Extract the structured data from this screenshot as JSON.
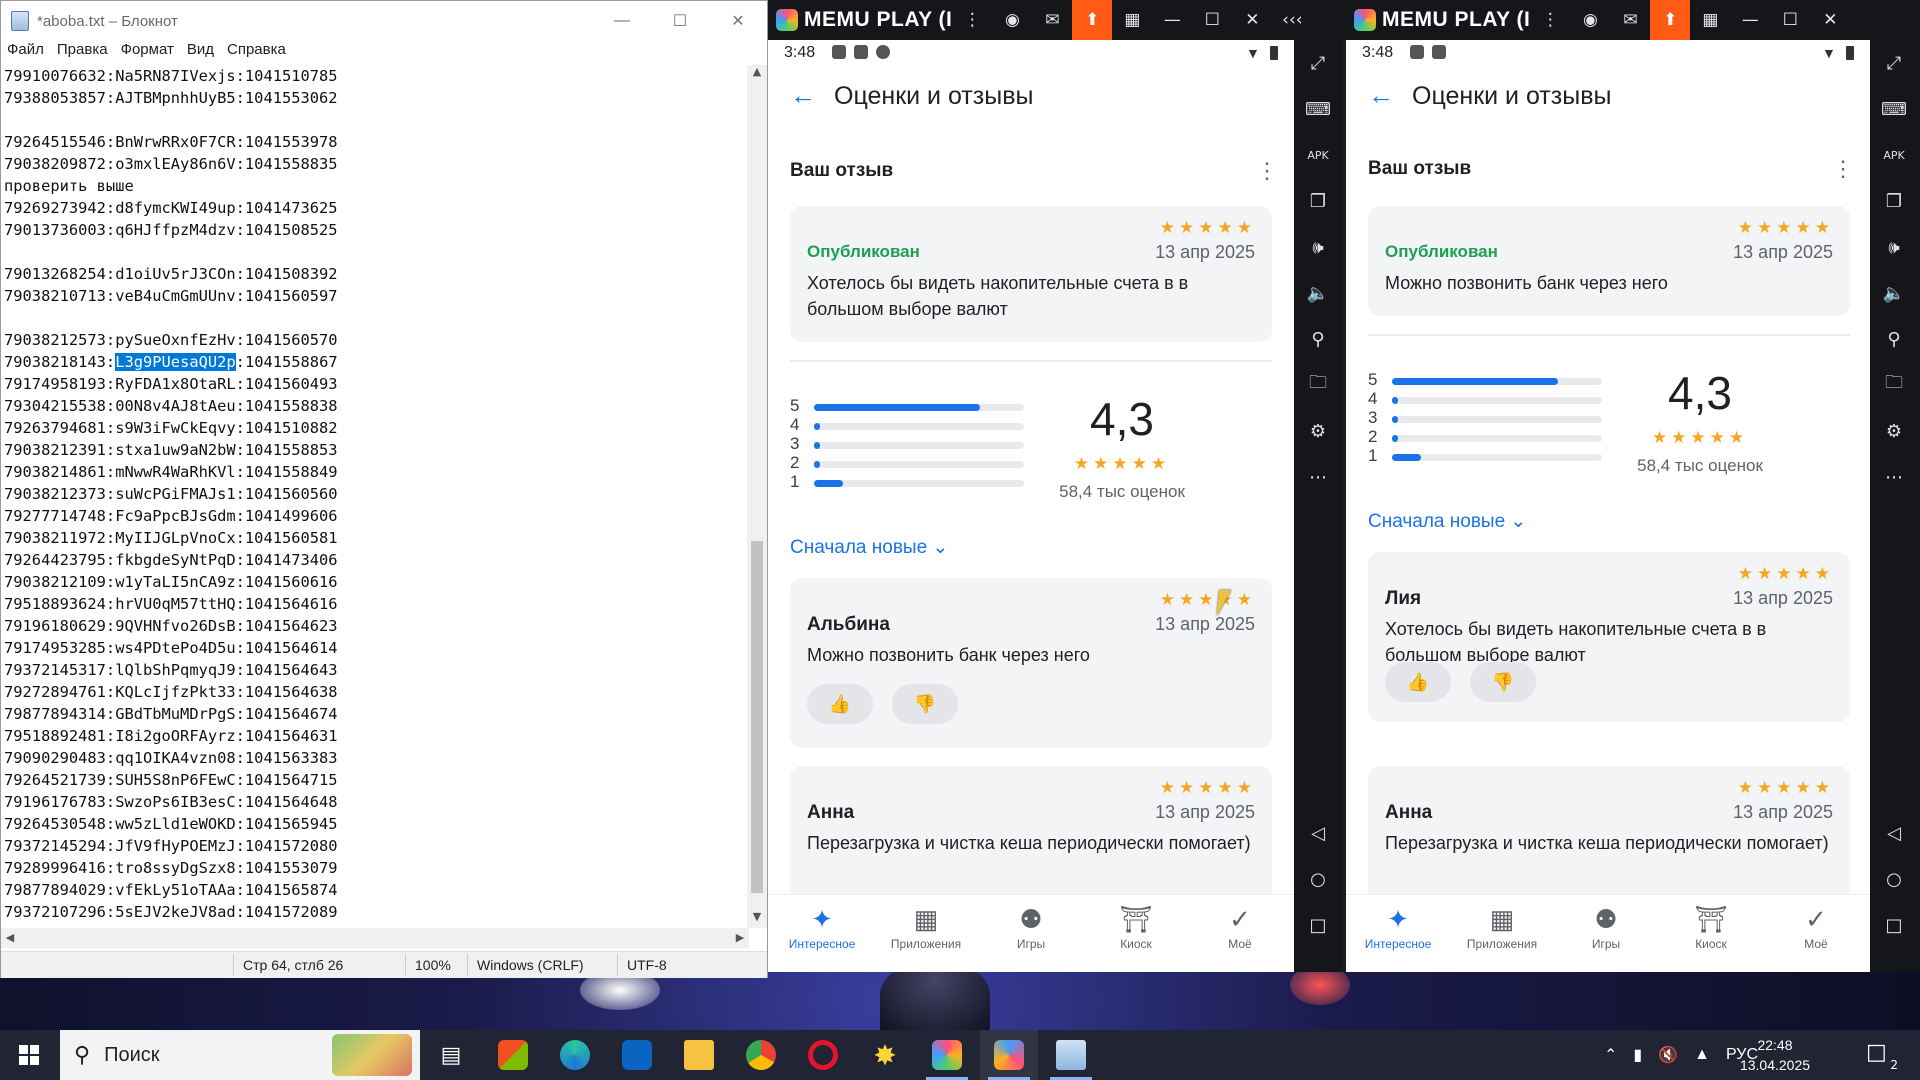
{
  "notepad": {
    "title": "*aboba.txt – Блокнот",
    "menu": [
      "Файл",
      "Правка",
      "Формат",
      "Вид",
      "Справка"
    ],
    "lines": [
      {
        "pre": "79910076632:Na5RN87IVexjs:1041510785"
      },
      {
        "pre": "79388053857:AJTBMpnhhUyB5:1041553062"
      },
      {
        "pre": ""
      },
      {
        "pre": "79264515546:BnWrwRRx0F7CR:1041553978"
      },
      {
        "pre": "79038209872:o3mxlEAy86n6V:1041558835"
      },
      {
        "pre": "проверить выше"
      },
      {
        "pre": "79269273942:d8fymcKWI49up:1041473625"
      },
      {
        "pre": "79013736003:q6HJffpzM4dzv:1041508525"
      },
      {
        "pre": ""
      },
      {
        "pre": "79013268254:d1oiUv5rJ3COn:1041508392"
      },
      {
        "pre": "79038210713:veB4uCmGmUUnv:1041560597"
      },
      {
        "pre": ""
      },
      {
        "pre": "79038212573:pySueOxnfEzHv:1041560570"
      },
      {
        "pre": "79038218143:",
        "sel": "L3g9PUesaQU2p",
        "post": ":1041558867"
      },
      {
        "pre": "79174958193:RyFDA1x8OtaRL:1041560493"
      },
      {
        "pre": "79304215538:00N8v4AJ8tAeu:1041558838"
      },
      {
        "pre": "79263794681:s9W3iFwCkEqvy:1041510882"
      },
      {
        "pre": "79038212391:stxa1uw9aN2bW:1041558853"
      },
      {
        "pre": "79038214861:mNwwR4WaRhKVl:1041558849"
      },
      {
        "pre": "79038212373:suWcPGiFMAJs1:1041560560"
      },
      {
        "pre": "79277714748:Fc9aPpcBJsGdm:1041499606"
      },
      {
        "pre": "79038211972:MyIIJGLpVnoCx:1041560581"
      },
      {
        "pre": "79264423795:fkbgdeSyNtPqD:1041473406"
      },
      {
        "pre": "79038212109:w1yTaLI5nCA9z:1041560616"
      },
      {
        "pre": "79518893624:hrVU0qM57ttHQ:1041564616"
      },
      {
        "pre": "79196180629:9QVHNfvo26DsB:1041564623"
      },
      {
        "pre": "79174953285:ws4PDtePo4D5u:1041564614"
      },
      {
        "pre": "79372145317:lQlbShPqmyqJ9:1041564643"
      },
      {
        "pre": "79272894761:KQLcIjfzPkt33:1041564638"
      },
      {
        "pre": "79877894314:GBdTbMuMDrPgS:1041564674"
      },
      {
        "pre": "79518892481:I8i2goORFAyrz:1041564631"
      },
      {
        "pre": "79090290483:qq1OIKA4vzn08:1041563383"
      },
      {
        "pre": "79264521739:SUH5S8nP6FEwC:1041564715"
      },
      {
        "pre": "79196176783:SwzoPs6IB3esC:1041564648"
      },
      {
        "pre": "79264530548:ww5zLld1eWOKD:1041565945"
      },
      {
        "pre": "79372145294:JfV9fHyPOEMzJ:1041572080"
      },
      {
        "pre": "79289996416:tro8ssyDgSzx8:1041553079"
      },
      {
        "pre": "79877894029:vfEkLy51oTAAa:1041565874"
      },
      {
        "pre": "79372107296:5sEJV2keJV8ad:1041572089"
      }
    ],
    "status": {
      "position": "Стр 64, стлб 26",
      "zoom": "100%",
      "eol": "Windows (CRLF)",
      "encoding": "UTF-8"
    }
  },
  "memu": {
    "brand": "MEMU PLAY (I",
    "accent": "#ff5b14"
  },
  "android_left": {
    "time": "3:48",
    "page_title": "Оценки и отзывы",
    "your_review_label": "Ваш отзыв",
    "my_review": {
      "status": "Опубликован",
      "date": "13 апр 2025",
      "text": "Хотелось бы видеть накопительные счета в в большом выборе валют"
    },
    "rating": {
      "score": "4,3",
      "count": "58,4 тыс оценок",
      "bars": [
        {
          "label": "5",
          "pct": 0.79
        },
        {
          "label": "4",
          "pct": 0.03
        },
        {
          "label": "3",
          "pct": 0.02
        },
        {
          "label": "2",
          "pct": 0.02
        },
        {
          "label": "1",
          "pct": 0.14
        }
      ]
    },
    "sort_label": "Сначала новые",
    "reviews": [
      {
        "author": "Альбина",
        "date": "13 апр 2025",
        "text": "Можно позвонить банк через него"
      },
      {
        "author": "Анна",
        "date": "13 апр 2025",
        "text": "Перезагрузка и чистка кеша периодически помогает)"
      }
    ]
  },
  "android_right": {
    "time": "3:48",
    "page_title": "Оценки и отзывы",
    "your_review_label": "Ваш отзыв",
    "my_review": {
      "status": "Опубликован",
      "date": "13 апр 2025",
      "text": "Можно позвонить банк через него"
    },
    "rating": {
      "score": "4,3",
      "count": "58,4 тыс оценок",
      "bars": [
        {
          "label": "5",
          "pct": 0.79
        },
        {
          "label": "4",
          "pct": 0.03
        },
        {
          "label": "3",
          "pct": 0.02
        },
        {
          "label": "2",
          "pct": 0.02
        },
        {
          "label": "1",
          "pct": 0.14
        }
      ]
    },
    "sort_label": "Сначала новые",
    "reviews": [
      {
        "author": "Лия",
        "date": "13 апр 2025",
        "text": "Хотелось бы видеть накопительные счета в в большом выборе валют"
      },
      {
        "author": "Анна",
        "date": "13 апр 2025",
        "text": "Перезагрузка и чистка кеша периодически помогает)"
      }
    ]
  },
  "bottom_nav": [
    "Интересное",
    "Приложения",
    "Игры",
    "Киоск",
    "Моё"
  ],
  "taskbar": {
    "search_placeholder": "Поиск",
    "lang": "РУС",
    "time": "22:48",
    "date": "13.04.2025",
    "notifications": "2"
  }
}
